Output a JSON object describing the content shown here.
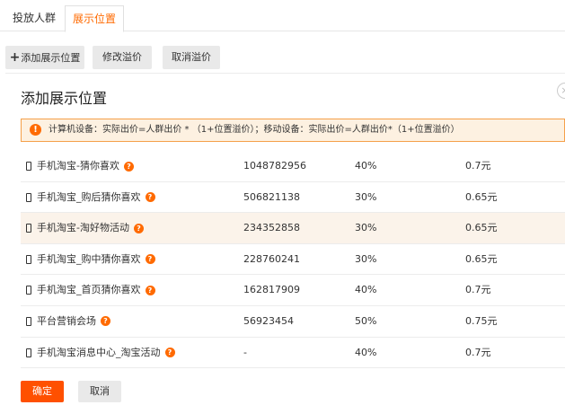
{
  "tabs": [
    {
      "label": "投放人群",
      "active": false
    },
    {
      "label": "展示位置",
      "active": true
    }
  ],
  "toolbar": {
    "add_icon": "+",
    "add_label": "添加展示位置",
    "modify_label": "修改溢价",
    "cancel_label": "取消溢价"
  },
  "panel": {
    "title": "添加展示位置",
    "close_icon": "×",
    "notice_icon": "!",
    "notice": "计算机设备：实际出价=人群出价 * （1+位置溢价）；移动设备：实际出价=人群出价*（1+位置溢价）"
  },
  "rows": [
    {
      "name": "手机淘宝-猜你喜欢",
      "count": "1048782956",
      "percent": "40%",
      "price": "0.7元",
      "highlight": false
    },
    {
      "name": "手机淘宝_购后猜你喜欢",
      "count": "506821138",
      "percent": "30%",
      "price": "0.65元",
      "highlight": false
    },
    {
      "name": "手机淘宝-淘好物活动",
      "count": "234352858",
      "percent": "30%",
      "price": "0.65元",
      "highlight": true
    },
    {
      "name": "手机淘宝_购中猜你喜欢",
      "count": "228760241",
      "percent": "30%",
      "price": "0.65元",
      "highlight": false
    },
    {
      "name": "手机淘宝_首页猜你喜欢",
      "count": "162817909",
      "percent": "40%",
      "price": "0.7元",
      "highlight": false
    },
    {
      "name": "平台营销会场",
      "count": "56923454",
      "percent": "50%",
      "price": "0.75元",
      "highlight": false
    },
    {
      "name": "手机淘宝消息中心_淘宝活动",
      "count": "-",
      "percent": "40%",
      "price": "0.7元",
      "highlight": false
    }
  ],
  "question_icon": "?",
  "footer": {
    "confirm_label": "确定",
    "cancel_label": "取消"
  },
  "colors": {
    "accent": "#ff6a00",
    "confirm": "#ff5000",
    "notice_bg": "#fdf1e1",
    "highlight_row": "#fbf3ea"
  }
}
